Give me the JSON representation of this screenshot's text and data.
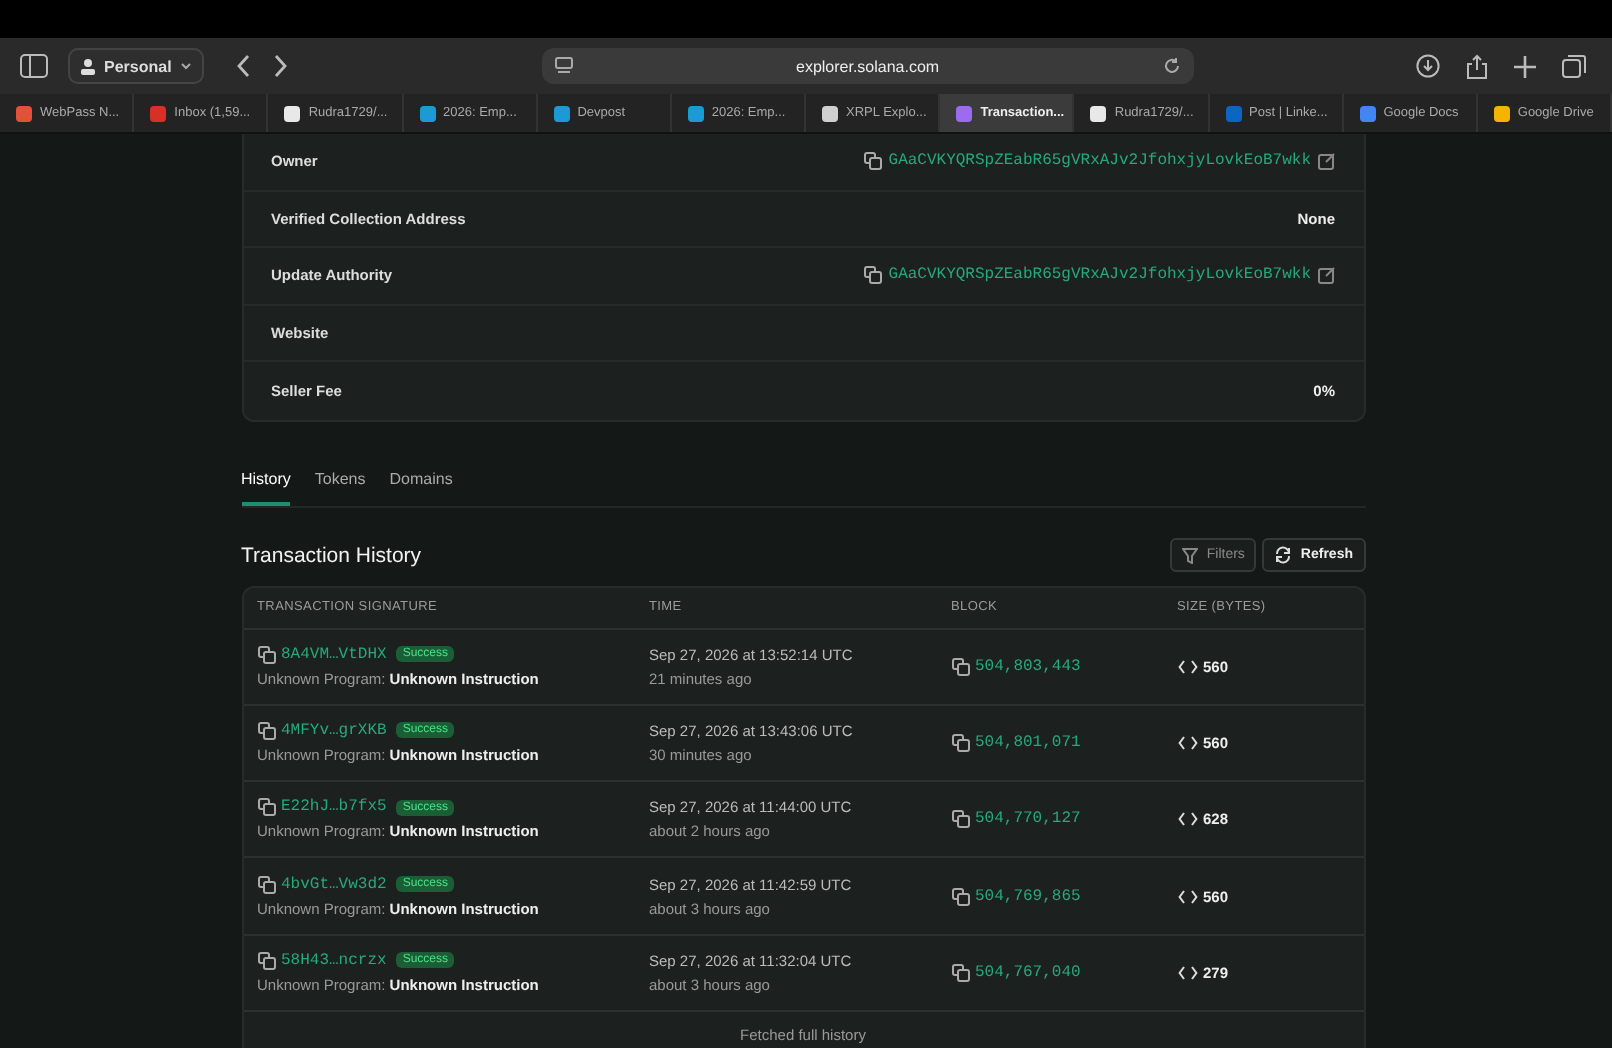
{
  "browser": {
    "profile": "Personal",
    "address": "explorer.solana.com"
  },
  "tabs": [
    {
      "title": "WebPass N...",
      "selected": false,
      "color": "#e0523a"
    },
    {
      "title": "Inbox (1,59...",
      "selected": false,
      "color": "#d93025"
    },
    {
      "title": "Rudra1729/...",
      "selected": false,
      "color": "#e8e8e8"
    },
    {
      "title": "2026: Emp...",
      "selected": false,
      "color": "#1c9ad6"
    },
    {
      "title": "Devpost",
      "selected": false,
      "color": "#1c9ad6"
    },
    {
      "title": "2026: Emp...",
      "selected": false,
      "color": "#1c9ad6"
    },
    {
      "title": "XRPL Explo...",
      "selected": false,
      "color": "#cfcfcf"
    },
    {
      "title": "Transaction...",
      "selected": true,
      "color": "#9b6bf0"
    },
    {
      "title": "Rudra1729/...",
      "selected": false,
      "color": "#e8e8e8"
    },
    {
      "title": "Post | Linke...",
      "selected": false,
      "color": "#0a66c2"
    },
    {
      "title": "Google Docs",
      "selected": false,
      "color": "#4285f4"
    },
    {
      "title": "Google Drive",
      "selected": false,
      "color": "#f4b400"
    }
  ],
  "details": [
    {
      "label": "Owner",
      "kind": "address",
      "value": "GAaCVKYQRSpZEabR65gVRxAJv2JfohxjyLovkEoB7wkk"
    },
    {
      "label": "Verified Collection Address",
      "kind": "text",
      "value": "None"
    },
    {
      "label": "Update Authority",
      "kind": "address",
      "value": "GAaCVKYQRSpZEabR65gVRxAJv2JfohxjyLovkEoB7wkk"
    },
    {
      "label": "Website",
      "kind": "text"
    },
    {
      "label": "Seller Fee",
      "kind": "text",
      "value": "0%"
    }
  ],
  "section_tabs": [
    {
      "label": "History",
      "selected": true
    },
    {
      "label": "Tokens",
      "selected": false
    },
    {
      "label": "Domains",
      "selected": false
    }
  ],
  "history": {
    "title": "Transaction History",
    "filters": "Filters",
    "refresh": "Refresh",
    "columns": [
      "TRANSACTION SIGNATURE",
      "TIME",
      "BLOCK",
      "SIZE (BYTES)"
    ],
    "rows": [
      {
        "signature": "8A4VM…VtDHX",
        "status": "Success",
        "program": "Unknown Program:",
        "instruction": "Unknown Instruction",
        "time": "Sep 27, 2026 at 13:52:14 UTC",
        "ago": "21 minutes ago",
        "block": "504,803,443",
        "size": "560"
      },
      {
        "signature": "4MFYv…grXKB",
        "status": "Success",
        "program": "Unknown Program:",
        "instruction": "Unknown Instruction",
        "time": "Sep 27, 2026 at 13:43:06 UTC",
        "ago": "30 minutes ago",
        "block": "504,801,071",
        "size": "560"
      },
      {
        "signature": "E22hJ…b7fx5",
        "status": "Success",
        "program": "Unknown Program:",
        "instruction": "Unknown Instruction",
        "time": "Sep 27, 2026 at 11:44:00 UTC",
        "ago": "about 2 hours ago",
        "block": "504,770,127",
        "size": "628"
      },
      {
        "signature": "4bvGt…Vw3d2",
        "status": "Success",
        "program": "Unknown Program:",
        "instruction": "Unknown Instruction",
        "time": "Sep 27, 2026 at 11:42:59 UTC",
        "ago": "about 3 hours ago",
        "block": "504,769,865",
        "size": "560"
      },
      {
        "signature": "58H43…ncrzx",
        "status": "Success",
        "program": "Unknown Program:",
        "instruction": "Unknown Instruction",
        "time": "Sep 27, 2026 at 11:32:04 UTC",
        "ago": "about 3 hours ago",
        "block": "504,767,040",
        "size": "279"
      }
    ],
    "footer": "Fetched full history"
  }
}
